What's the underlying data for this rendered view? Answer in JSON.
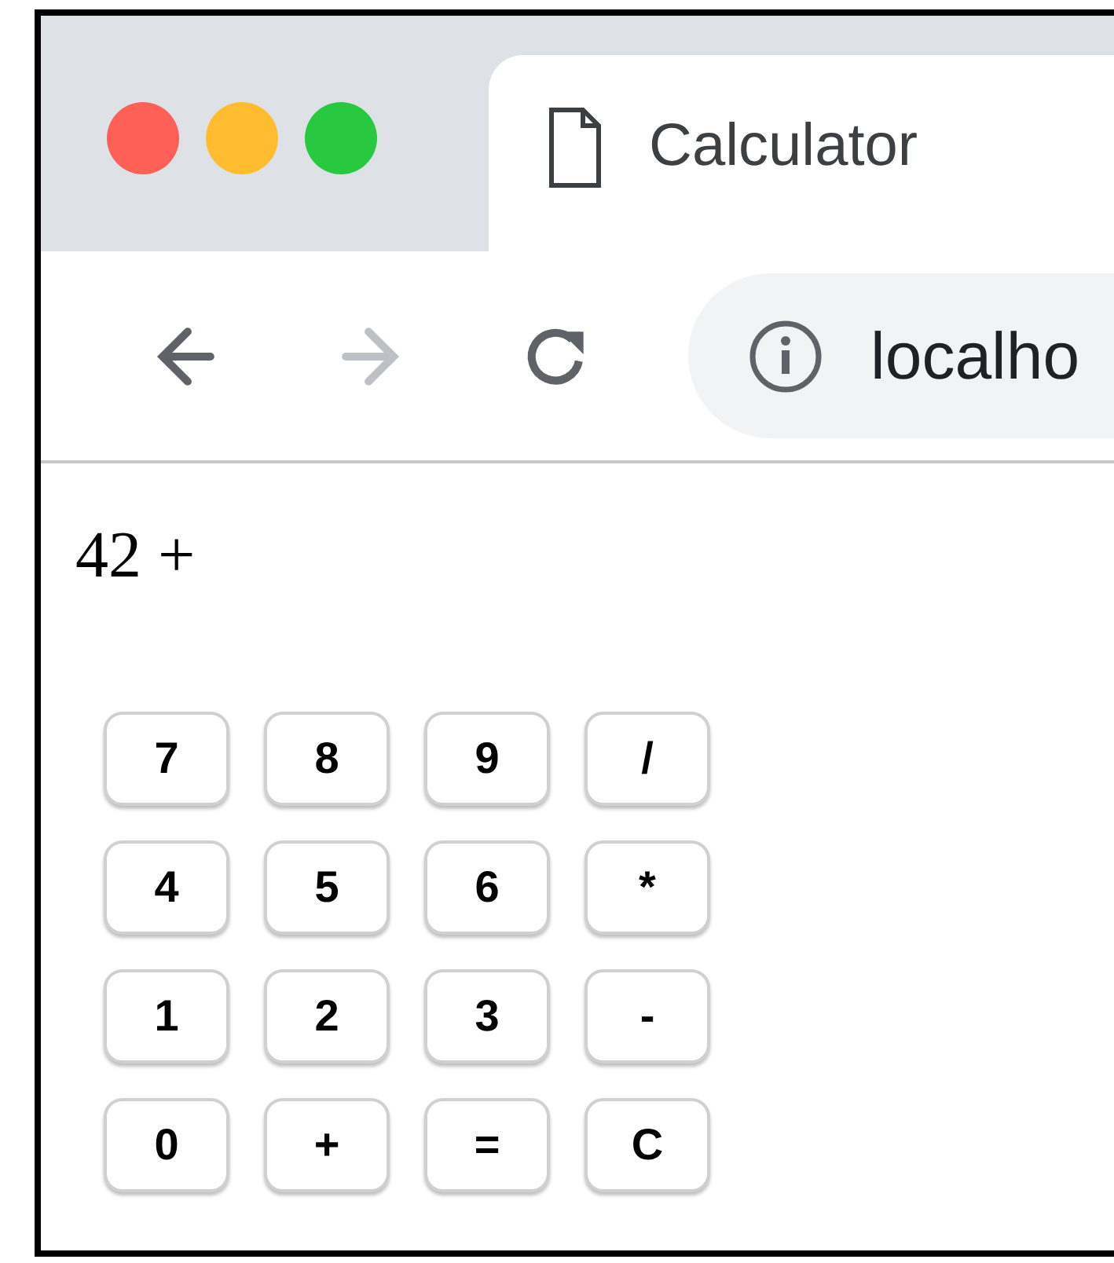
{
  "tab": {
    "title": "Calculator"
  },
  "nav_buttons": [
    {
      "kind": "back",
      "disabled": false
    },
    {
      "kind": "forward",
      "disabled": true
    },
    {
      "kind": "reload",
      "disabled": false
    }
  ],
  "address_bar": {
    "text": "localho"
  },
  "display": "42 +",
  "keys": [
    "7",
    "8",
    "9",
    "/",
    "4",
    "5",
    "6",
    "*",
    "1",
    "2",
    "3",
    "-",
    "0",
    "+",
    "=",
    "C"
  ]
}
